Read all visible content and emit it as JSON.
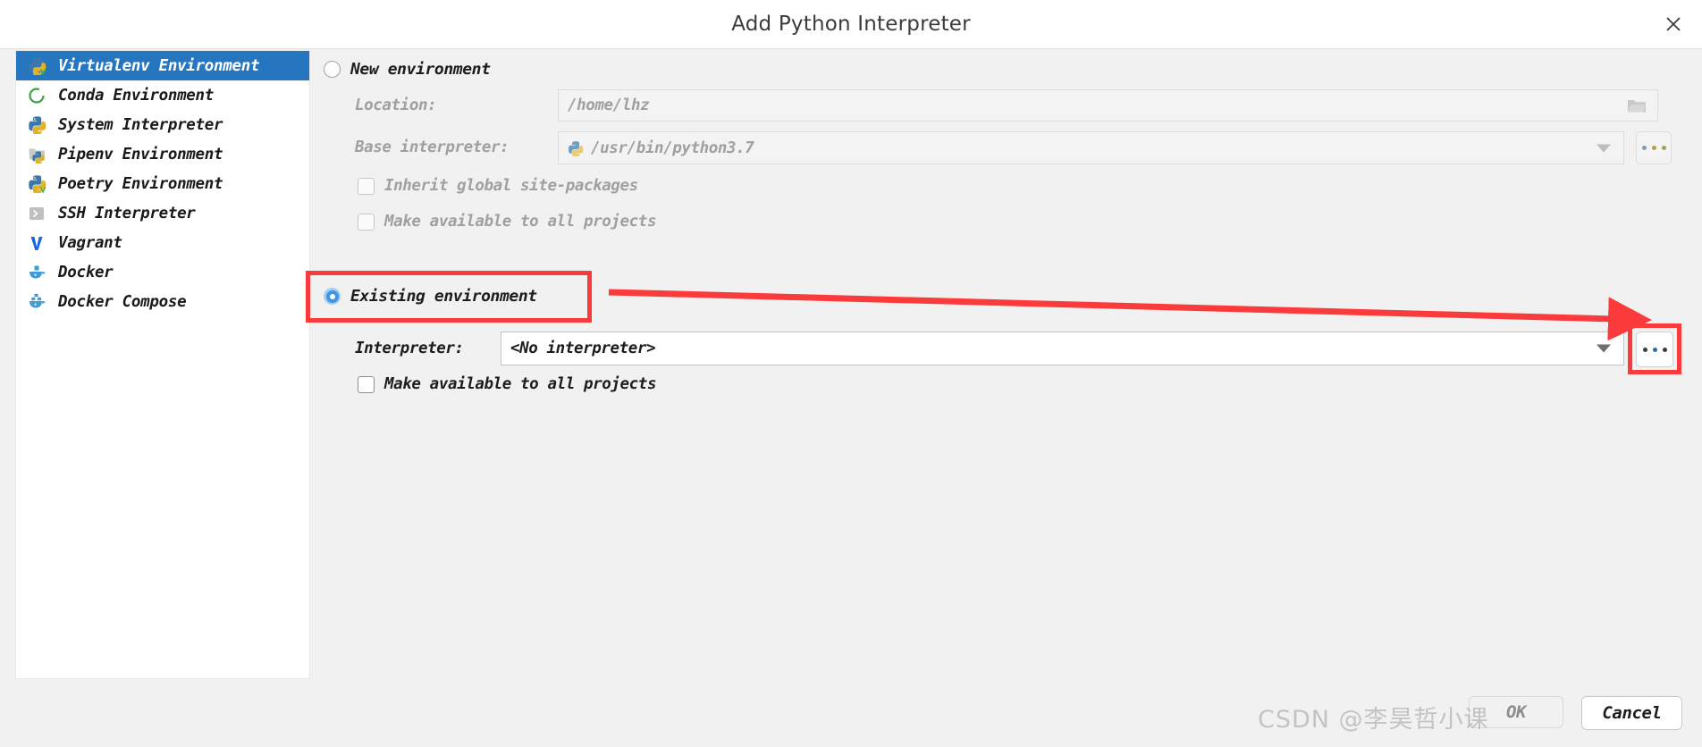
{
  "window": {
    "title": "Add Python Interpreter",
    "close_icon": "close-icon"
  },
  "sidebar": {
    "items": [
      {
        "label": "Virtualenv Environment",
        "icon": "python-virtualenv-icon",
        "selected": true
      },
      {
        "label": "Conda Environment",
        "icon": "conda-icon",
        "selected": false
      },
      {
        "label": "System Interpreter",
        "icon": "python-icon",
        "selected": false
      },
      {
        "label": "Pipenv Environment",
        "icon": "pipenv-icon",
        "selected": false
      },
      {
        "label": "Poetry Environment",
        "icon": "poetry-icon",
        "selected": false
      },
      {
        "label": "SSH Interpreter",
        "icon": "ssh-terminal-icon",
        "selected": false
      },
      {
        "label": "Vagrant",
        "icon": "vagrant-icon",
        "selected": false
      },
      {
        "label": "Docker",
        "icon": "docker-icon",
        "selected": false
      },
      {
        "label": "Docker Compose",
        "icon": "docker-compose-icon",
        "selected": false
      }
    ]
  },
  "main": {
    "new_environment": {
      "radio_label": "New environment",
      "selected": false,
      "location": {
        "label": "Location:",
        "value": "/home/lhz",
        "browse_icon": "folder-icon"
      },
      "base_interpreter": {
        "label": "Base interpreter:",
        "value": "/usr/bin/python3.7",
        "icon": "python-icon",
        "dropdown_icon": "chevron-down-icon",
        "browse_button": "..."
      },
      "inherit_site_packages": {
        "label": "Inherit global site-packages",
        "checked": false
      },
      "make_available_all_projects": {
        "label": "Make available to all projects",
        "checked": false
      }
    },
    "existing_environment": {
      "radio_label": "Existing environment",
      "selected": true,
      "interpreter": {
        "label": "Interpreter:",
        "value": "<No interpreter>",
        "dropdown_icon": "chevron-down-icon",
        "browse_button": "..."
      },
      "make_available_all_projects": {
        "label": "Make available to all projects",
        "checked": false
      }
    }
  },
  "footer": {
    "ok_label": "OK",
    "cancel_label": "Cancel"
  },
  "watermark": {
    "text": "CSDN @李昊哲小课"
  },
  "annotations": {
    "highlight_color": "#fb3b3b",
    "accent_color": "#2675bf"
  }
}
